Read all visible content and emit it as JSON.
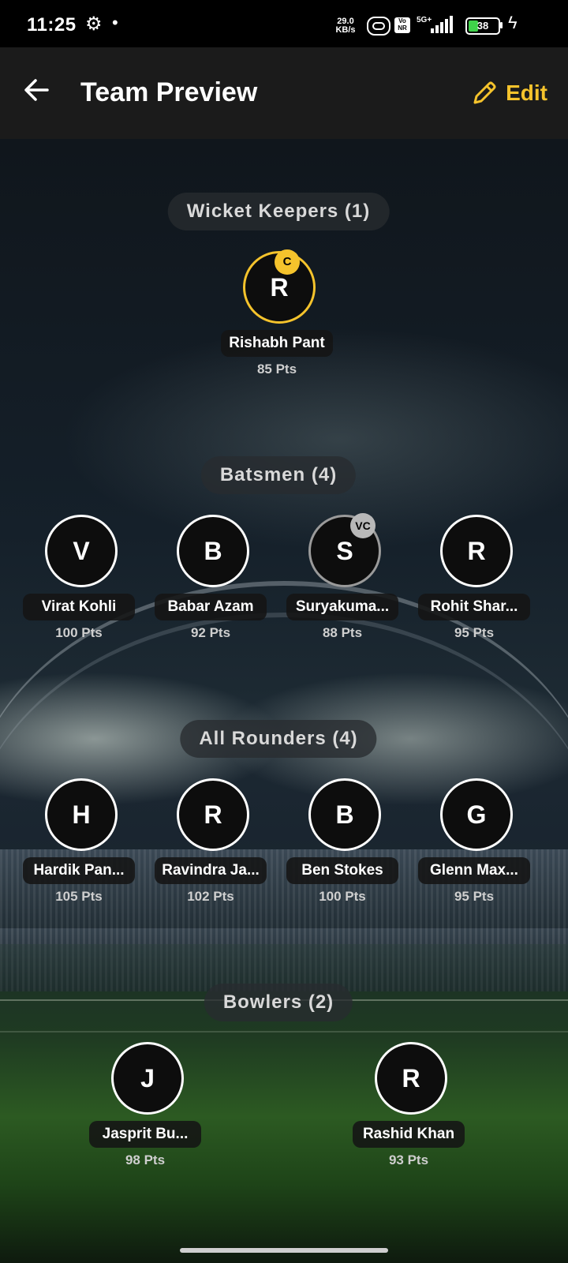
{
  "status_bar": {
    "time": "11:25",
    "net_speed_value": "29.0",
    "net_speed_unit": "KB/s",
    "network": "5G+",
    "volte": "Vo NR",
    "battery": "38",
    "icons": [
      "gear-icon",
      "hd-icon",
      "signal-icon",
      "battery-icon",
      "charging-icon"
    ]
  },
  "header": {
    "title": "Team Preview",
    "edit_label": "Edit",
    "accent": "#f5c32c"
  },
  "sections": {
    "wicket_keepers": {
      "label": "Wicket Keepers (1)",
      "players": [
        {
          "initial": "R",
          "name": "Rishabh Pant",
          "points": "85 Pts",
          "role_badge": "C"
        }
      ]
    },
    "batsmen": {
      "label": "Batsmen (4)",
      "players": [
        {
          "initial": "V",
          "name": "Virat Kohli",
          "points": "100 Pts"
        },
        {
          "initial": "B",
          "name": "Babar Azam",
          "points": "92 Pts"
        },
        {
          "initial": "S",
          "name": "Suryakuma...",
          "points": "88 Pts",
          "role_badge": "VC"
        },
        {
          "initial": "R",
          "name": "Rohit Shar...",
          "points": "95 Pts"
        }
      ]
    },
    "all_rounders": {
      "label": "All Rounders (4)",
      "players": [
        {
          "initial": "H",
          "name": "Hardik Pan...",
          "points": "105 Pts"
        },
        {
          "initial": "R",
          "name": "Ravindra Ja...",
          "points": "102 Pts"
        },
        {
          "initial": "B",
          "name": "Ben Stokes",
          "points": "100 Pts"
        },
        {
          "initial": "G",
          "name": "Glenn Max...",
          "points": "95 Pts"
        }
      ]
    },
    "bowlers": {
      "label": "Bowlers (2)",
      "players": [
        {
          "initial": "J",
          "name": "Jasprit Bu...",
          "points": "98 Pts"
        },
        {
          "initial": "R",
          "name": "Rashid Khan",
          "points": "93 Pts"
        }
      ]
    }
  }
}
